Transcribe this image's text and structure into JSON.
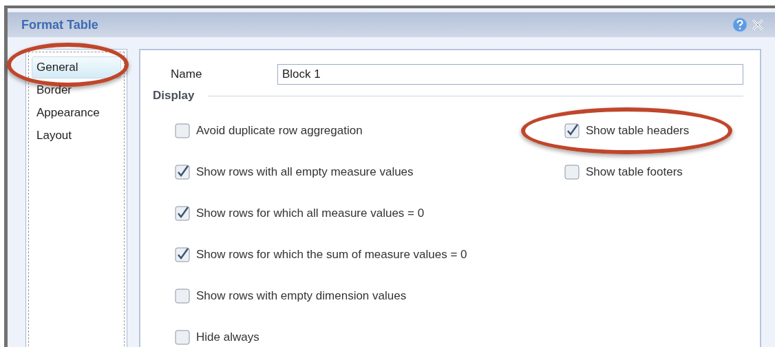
{
  "window": {
    "title": "Format Table"
  },
  "sidebar": {
    "items": [
      {
        "label": "General",
        "selected": true,
        "circled": true
      },
      {
        "label": "Border",
        "selected": false,
        "circled": false
      },
      {
        "label": "Appearance",
        "selected": false,
        "circled": false
      },
      {
        "label": "Layout",
        "selected": false,
        "circled": false
      }
    ]
  },
  "name_field": {
    "label": "Name",
    "value": "Block 1"
  },
  "display": {
    "heading": "Display",
    "left_options": [
      {
        "label": "Avoid duplicate row aggregation",
        "checked": false,
        "circled": false
      },
      {
        "label": "Show rows with all empty measure values",
        "checked": true,
        "circled": false
      },
      {
        "label": "Show rows for which all measure values = 0",
        "checked": true,
        "circled": false
      },
      {
        "label": "Show rows for which the sum of measure values = 0",
        "checked": true,
        "circled": false
      },
      {
        "label": "Show rows with empty dimension values",
        "checked": false,
        "circled": false
      },
      {
        "label": "Hide always",
        "checked": false,
        "circled": false
      }
    ],
    "right_options": [
      {
        "label": "Show table headers",
        "checked": true,
        "circled": true
      },
      {
        "label": "Show table footers",
        "checked": false,
        "circled": false
      }
    ]
  }
}
